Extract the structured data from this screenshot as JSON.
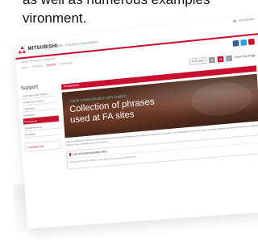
{
  "caption": {
    "line1": "",
    "line2": "as well as numerous examples",
    "line3": "vironment."
  },
  "header": {
    "brand": "MITSUBISHI",
    "site_title": "Global - Factory Automation",
    "language": "Worldwide"
  },
  "nav": {
    "breadcrumb": "Home  ›  Products  ›  Support  ›",
    "tabs": [
      {
        "label": "Home",
        "active": false
      },
      {
        "label": "Products",
        "active": false
      },
      {
        "label": "Support",
        "active": true
      },
      {
        "label": "Download",
        "active": false
      }
    ]
  },
  "social": {
    "colors": [
      "#3b5998",
      "#1da1f2",
      "#c8102e"
    ]
  },
  "toolbar": {
    "font_size_label": "Font size",
    "sizes": [
      "S",
      "M",
      "L"
    ],
    "print_label": "Print This Page"
  },
  "sidebar": {
    "heading": "Support",
    "items": [
      {
        "label": "Information and Support",
        "active": false
      },
      {
        "label": "e-Learning Courses",
        "active": false
      },
      {
        "label": "e-Manuals",
        "active": false
      },
      {
        "label": "Glossaries",
        "active": false
      },
      {
        "label": "Phrasebook",
        "active": true
      },
      {
        "label": "Service Network",
        "active": false
      }
    ],
    "feedback": "Feedback",
    "contact": "Contact Us"
  },
  "main": {
    "section_title": "Phrasebook",
    "banner_sub": "Useful communication with English",
    "banner_title_1": "Collection of phrases",
    "banner_title_2": "used at FA sites",
    "description": "These phrasebooks can be used to support communication between local staff and Japanese engineers. The phrasebooks contain many everyday phrases as well as numerous examples related to the manufacturing environment.",
    "list_heading": "List of downloadable files",
    "list_body": "Download files by clicking on the links for the relevant languages."
  },
  "colors": {
    "accent": "#c8102e",
    "banner_text_sub": "#5fc8b6"
  }
}
